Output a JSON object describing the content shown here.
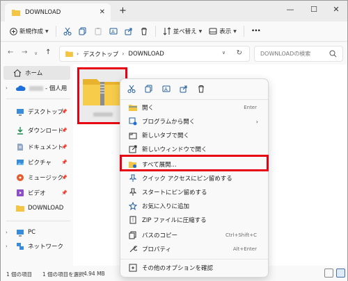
{
  "tab": {
    "title": "DOWNLOAD",
    "close": "✕",
    "new_tab": "+"
  },
  "window_controls": {
    "minimize": "—",
    "maximize": "☐",
    "close": "✕"
  },
  "toolbar": {
    "new_label": "新規作成",
    "sort_label": "並べ替え",
    "view_label": "表示",
    "more": "•••"
  },
  "address": {
    "crumbs": [
      "デスクトップ",
      "DOWNLOAD"
    ],
    "search_placeholder": "DOWNLOADの検索"
  },
  "sidebar": {
    "home": "ホーム",
    "personal": "- 個人用",
    "quick": [
      {
        "label": "デスクトップ",
        "icon": "desktop-icon"
      },
      {
        "label": "ダウンロード",
        "icon": "download-icon"
      },
      {
        "label": "ドキュメント",
        "icon": "document-icon"
      },
      {
        "label": "ピクチャ",
        "icon": "pictures-icon"
      },
      {
        "label": "ミュージック",
        "icon": "music-icon"
      },
      {
        "label": "ビデオ",
        "icon": "video-icon"
      },
      {
        "label": "DOWNLOAD",
        "icon": "folder-icon"
      }
    ],
    "pc": "PC",
    "network": "ネットワーク"
  },
  "status": {
    "count": "1 個の項目",
    "selected": "1 個の項目を選択",
    "size": "4.94 MB"
  },
  "menu": {
    "items": [
      {
        "label": "開く",
        "accel": "Enter",
        "icon": "folder-open-icon"
      },
      {
        "label": "プログラムから開く",
        "accel": "",
        "icon": "open-with-icon",
        "submenu": true
      },
      {
        "label": "新しいタブで開く",
        "accel": "",
        "icon": "new-tab-icon"
      },
      {
        "label": "新しいウィンドウで開く",
        "accel": "",
        "icon": "new-window-icon"
      },
      {
        "label": "すべて展開...",
        "accel": "",
        "icon": "extract-all-icon"
      },
      {
        "label": "クイック アクセスにピン留めする",
        "accel": "",
        "icon": "pin-icon"
      },
      {
        "label": "スタートにピン留めする",
        "accel": "",
        "icon": "pin-start-icon"
      },
      {
        "label": "お気に入りに追加",
        "accel": "",
        "icon": "star-icon"
      },
      {
        "label": "ZIP ファイルに圧縮する",
        "accel": "",
        "icon": "zip-icon"
      },
      {
        "label": "パスのコピー",
        "accel": "Ctrl+Shift+C",
        "icon": "copy-path-icon"
      },
      {
        "label": "プロパティ",
        "accel": "Alt+Enter",
        "icon": "properties-icon"
      },
      {
        "label": "その他のオプションを確認",
        "accel": "",
        "icon": "more-options-icon"
      }
    ]
  },
  "colors": {
    "highlight": "#e60012",
    "folder": "#f4c542",
    "accent": "#0067c0"
  }
}
